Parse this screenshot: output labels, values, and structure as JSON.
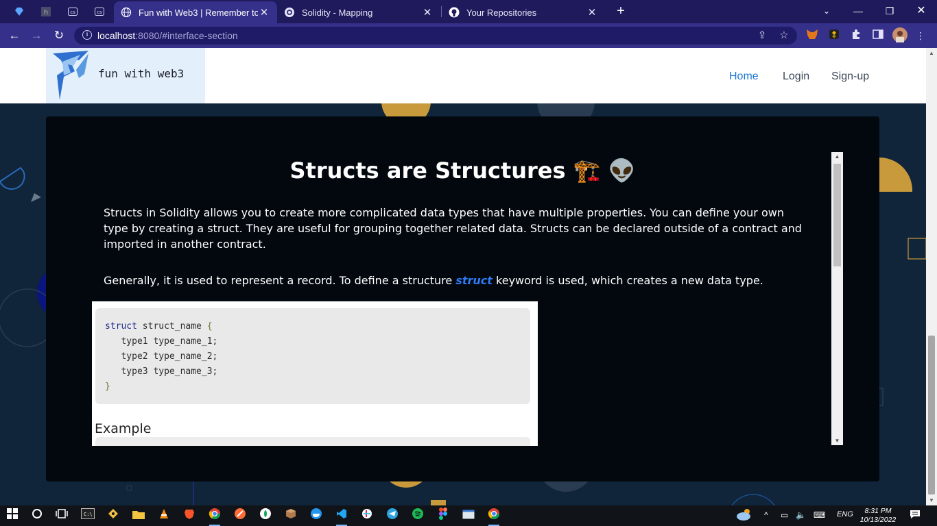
{
  "browser": {
    "tabs": [
      {
        "title": "Fun with Web3 | Remember to fu",
        "active": true
      },
      {
        "title": "Solidity - Mapping",
        "active": false
      },
      {
        "title": "Your Repositories",
        "active": false
      }
    ],
    "url_host": "localhost",
    "url_rest": ":8080/#interface-section",
    "new_tab_label": "+"
  },
  "site": {
    "logo_text": "fun with web3",
    "nav": [
      {
        "label": "Home",
        "active": true
      },
      {
        "label": "Login",
        "active": false
      },
      {
        "label": "Sign-up",
        "active": false
      }
    ]
  },
  "content": {
    "heading": "Structs are Structures 🏗️ 👽",
    "para1": "Structs in Solidity allows you to create more complicated data types that have multiple properties. You can define your own type by creating a struct. They are useful for grouping together related data. Structs can be declared outside of a contract and imported in another contract.",
    "para2_before": "Generally, it is used to represent a record. To define a structure ",
    "para2_keyword": "struct",
    "para2_after": " keyword is used, which creates a new data type.",
    "code": {
      "keyword": "struct",
      "line1_rest": " struct_name ",
      "open": "{",
      "lines": [
        "   type1 type_name_1;",
        "   type2 type_name_2;",
        "   type3 type_name_3;"
      ],
      "close": "}"
    },
    "example_heading": "Example"
  },
  "taskbar": {
    "language": "ENG",
    "time": "8:31 PM",
    "date": "10/13/2022"
  },
  "colors": {
    "tabbar": "#1f1a5c",
    "address_bar": "#35308a",
    "page_bg": "#10243a",
    "panel_bg": "#03080f",
    "nav_active": "#1b78d6",
    "keyword": "#2d7cf6",
    "deco_gold": "#c89a3c"
  }
}
